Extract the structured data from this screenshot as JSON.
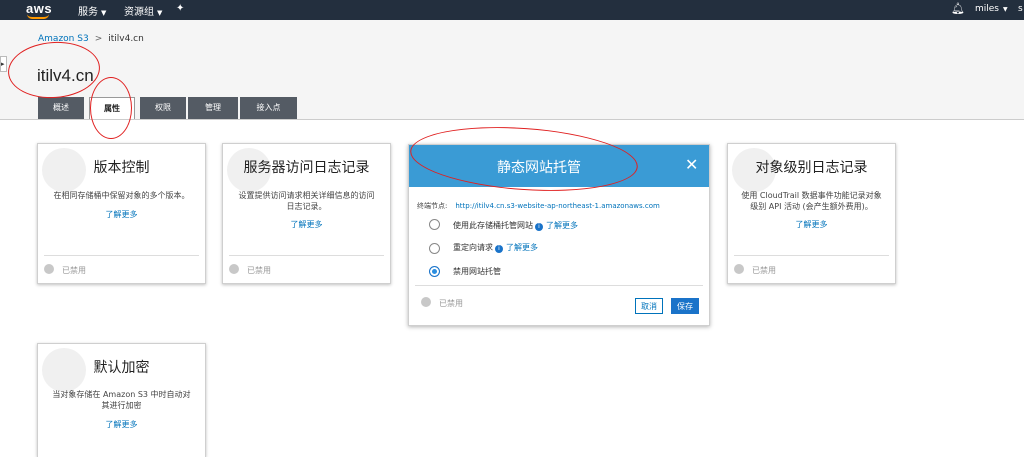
{
  "topbar": {
    "logo": "aws",
    "services_label": "服务",
    "resource_groups_label": "资源组",
    "pin_icon": "pin-icon",
    "bell_icon": "bell-icon",
    "user": "miles",
    "region_trunc": "s"
  },
  "breadcrumb": {
    "root": "Amazon S3",
    "separator": ">",
    "current": "itilv4.cn"
  },
  "page_title": "itilv4.cn",
  "tabs": [
    {
      "label": "概述"
    },
    {
      "label": "属性"
    },
    {
      "label": "权限"
    },
    {
      "label": "管理"
    },
    {
      "label": "接入点"
    }
  ],
  "cards": {
    "versioning": {
      "title": "版本控制",
      "desc": "在相同存储桶中保留对象的多个版本。",
      "link": "了解更多",
      "status": "已禁用"
    },
    "server_access_logging": {
      "title": "服务器访问日志记录",
      "desc": "设置提供访问请求相关详细信息的访问日志记录。",
      "link": "了解更多",
      "status": "已禁用"
    },
    "object_logging": {
      "title": "对象级别日志记录",
      "desc": "使用 CloudTrail 数据事件功能记录对象级别 API 活动 (会产生额外费用)。",
      "link": "了解更多",
      "status": "已禁用"
    },
    "default_encryption": {
      "title": "默认加密",
      "desc": "当对象存储在 Amazon S3 中时自动对其进行加密",
      "link": "了解更多"
    }
  },
  "website_modal": {
    "title": "静态网站托管",
    "close_icon": "close-icon",
    "endpoint_label": "终端节点:",
    "endpoint_url": "http://itilv4.cn.s3-website-ap-northeast-1.amazonaws.com",
    "options": [
      {
        "label": "使用此存储桶托管网站",
        "link": "了解更多",
        "selected": false
      },
      {
        "label": "重定向请求",
        "link": "了解更多",
        "selected": false
      },
      {
        "label": "禁用网站托管",
        "link": "",
        "selected": true
      }
    ],
    "status": "已禁用",
    "cancel": "取消",
    "save": "保存"
  },
  "colors": {
    "topbar": "#232f3e",
    "accent": "#0073bb",
    "modal_header": "#3a9bd5",
    "annotation": "#e02020"
  }
}
